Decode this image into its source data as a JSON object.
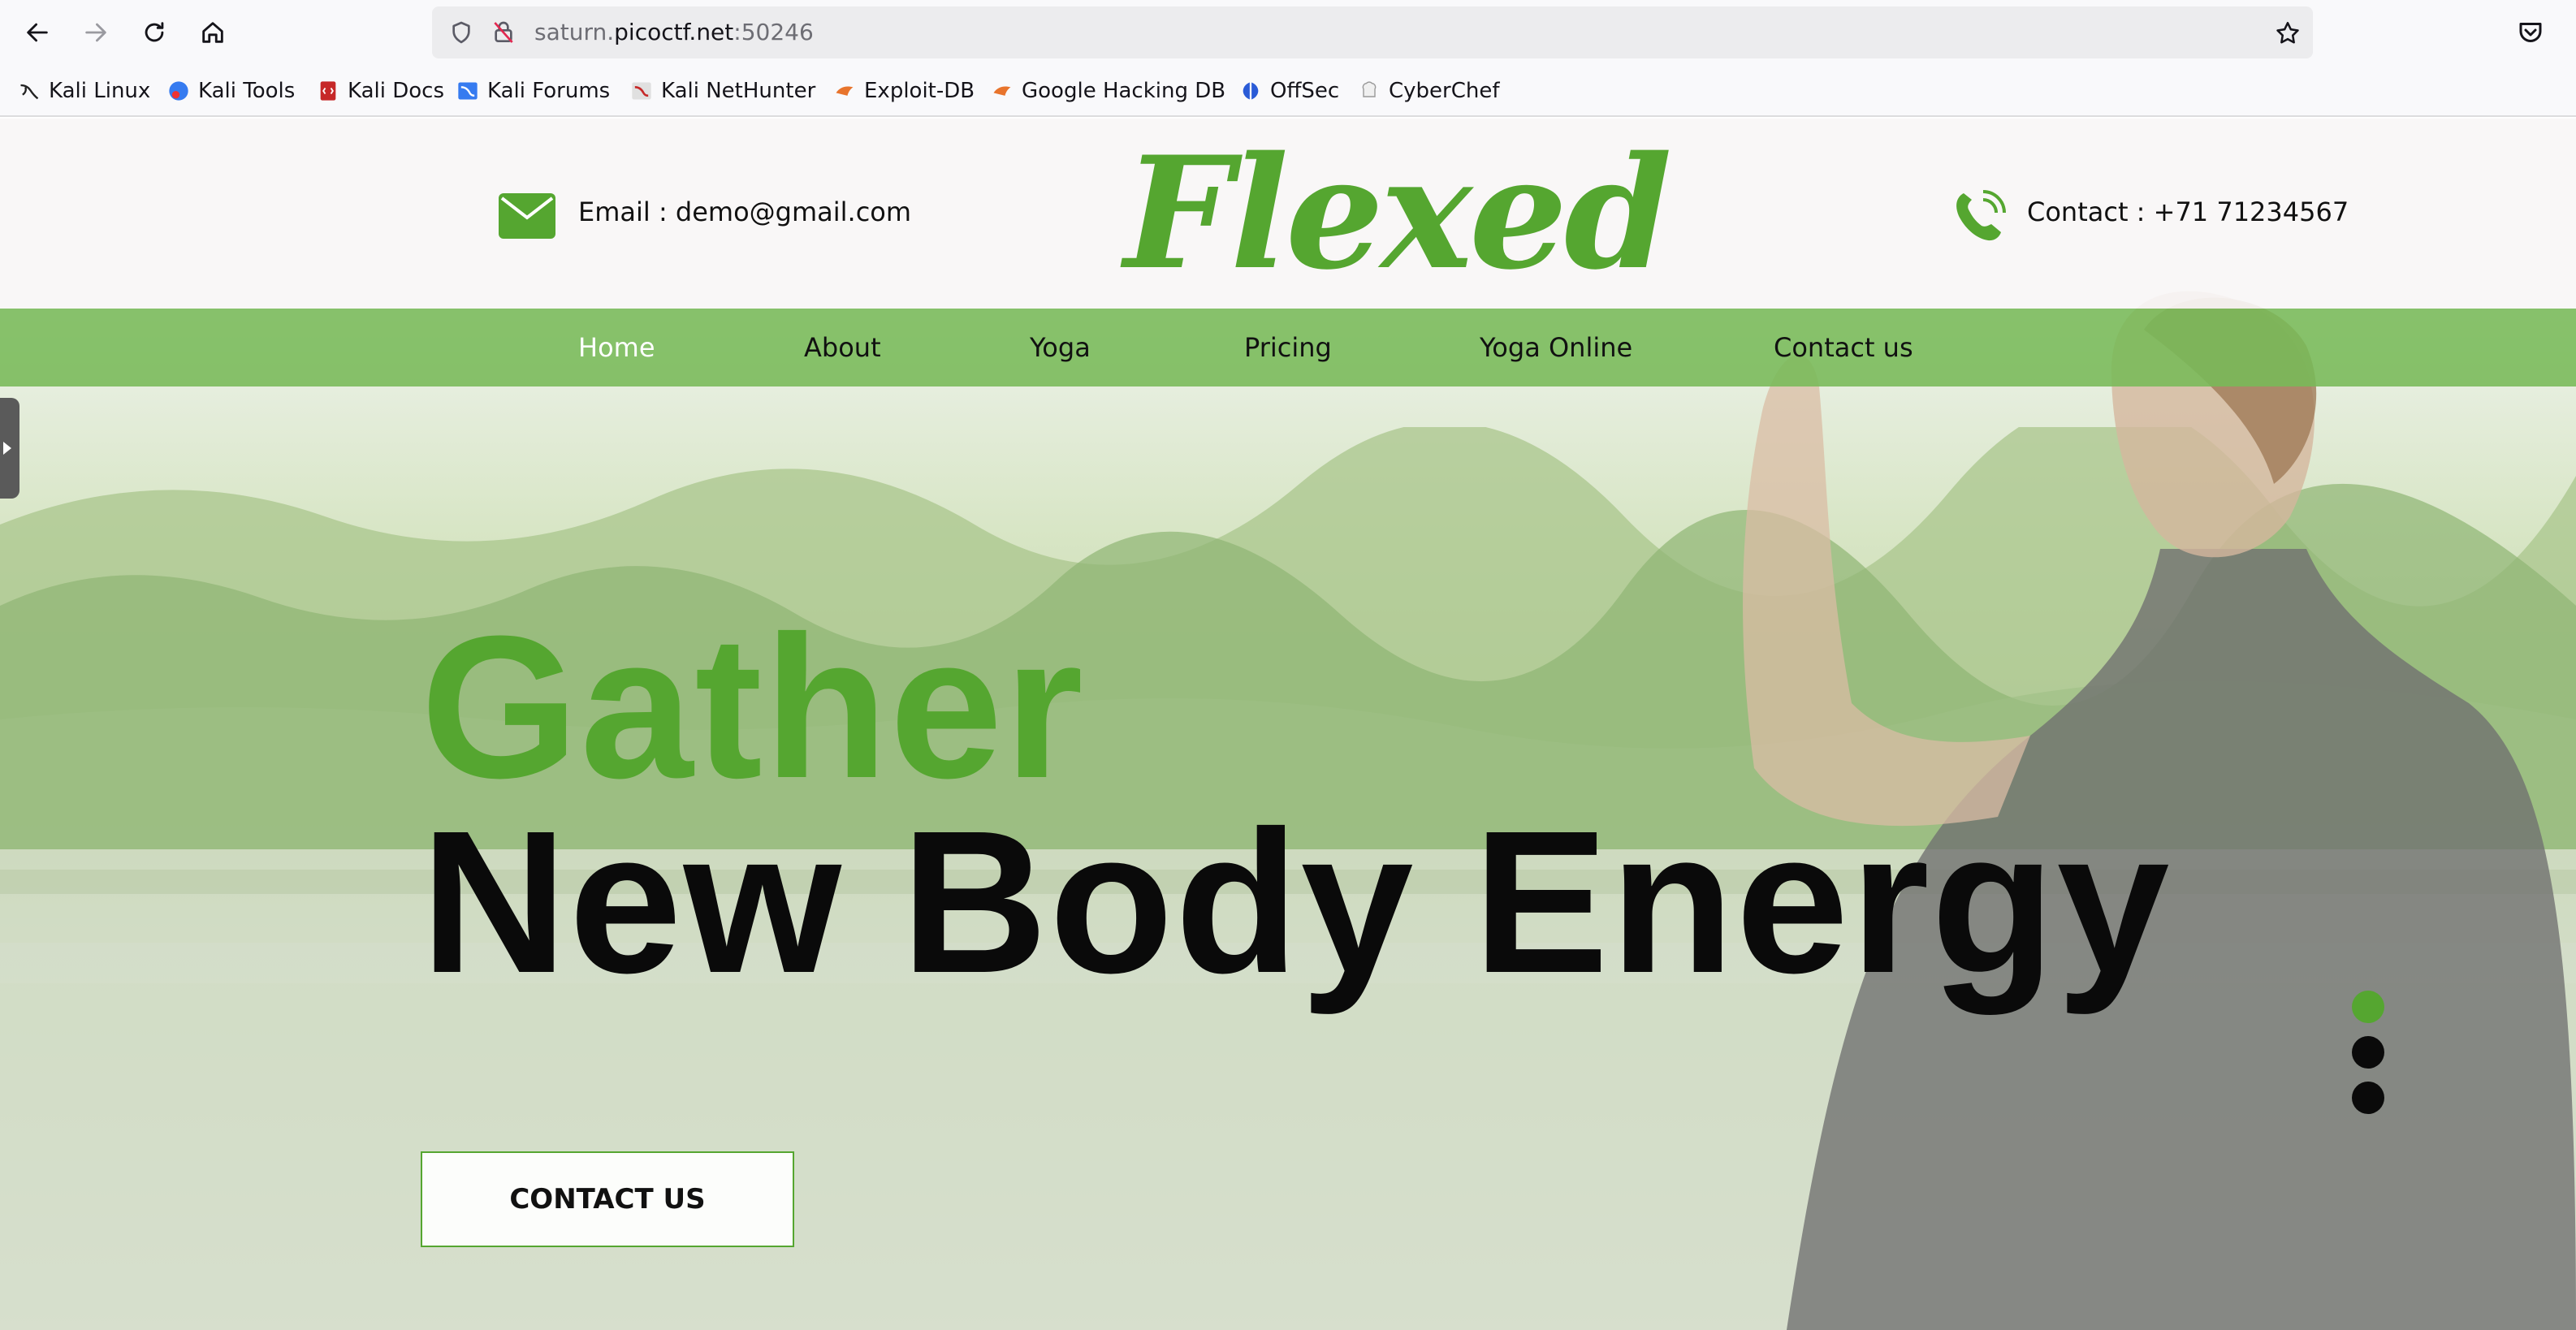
{
  "browser": {
    "url_prefix": "saturn.",
    "url_host": "picoctf.net",
    "url_port": ":50246",
    "bookmarks": [
      {
        "label": "Kali Linux",
        "icon": "kali-dragon-icon"
      },
      {
        "label": "Kali Tools",
        "icon": "kali-tools-icon"
      },
      {
        "label": "Kali Docs",
        "icon": "kali-docs-icon"
      },
      {
        "label": "Kali Forums",
        "icon": "kali-forums-icon"
      },
      {
        "label": "Kali NetHunter",
        "icon": "kali-nethunter-icon"
      },
      {
        "label": "Exploit-DB",
        "icon": "exploit-db-icon"
      },
      {
        "label": "Google Hacking DB",
        "icon": "ghdb-icon"
      },
      {
        "label": "OffSec",
        "icon": "offsec-icon"
      },
      {
        "label": "CyberChef",
        "icon": "cyberchef-icon"
      }
    ]
  },
  "site": {
    "email": "Email : demo@gmail.com",
    "logo": "Flexed",
    "contact": "Contact : +71 71234567",
    "brand_color": "#55a630",
    "menu": [
      {
        "label": "Home",
        "active": true
      },
      {
        "label": "About"
      },
      {
        "label": "Yoga"
      },
      {
        "label": "Pricing"
      },
      {
        "label": "Yoga Online"
      },
      {
        "label": "Contact us"
      }
    ],
    "hero": {
      "line1": "Gather",
      "line2": "New Body Energy",
      "cta": "CONTACT US",
      "slides": 3,
      "active_slide": 1
    }
  }
}
